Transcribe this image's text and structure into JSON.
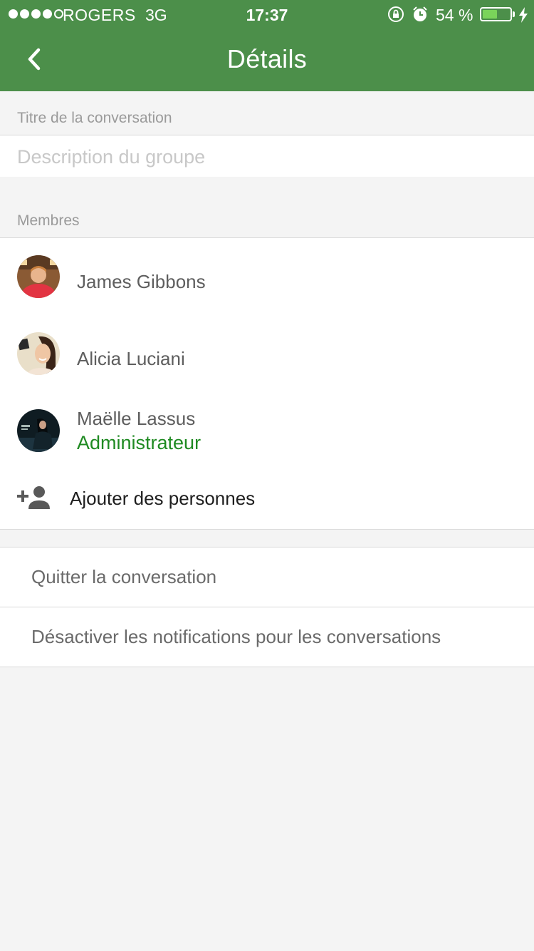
{
  "status_bar": {
    "carrier": "ROGERS",
    "network": "3G",
    "time": "17:37",
    "battery": "54 %",
    "battery_level": 0.54,
    "signal_bars_filled": 4,
    "icons": [
      "orientation-lock-icon",
      "alarm-icon",
      "battery-icon",
      "charging-bolt-icon"
    ]
  },
  "nav": {
    "title": "Détails",
    "back_icon": "chevron-left-icon"
  },
  "conversation": {
    "title_label": "Titre de la conversation",
    "description_placeholder": "Description du groupe"
  },
  "members": {
    "label": "Membres",
    "items": [
      {
        "name": "James Gibbons",
        "role": ""
      },
      {
        "name": "Alicia Luciani",
        "role": ""
      },
      {
        "name": "Maëlle Lassus",
        "role": "Administrateur"
      }
    ],
    "add_label": "Ajouter des personnes",
    "add_icon": "add-person-icon"
  },
  "actions": {
    "leave": "Quitter la conversation",
    "mute": "Désactiver les notifications pour les conversations"
  },
  "colors": {
    "header": "#4c8f4a",
    "admin": "#1f8a22",
    "battery": "#7ad35a",
    "background": "#f4f4f4"
  }
}
